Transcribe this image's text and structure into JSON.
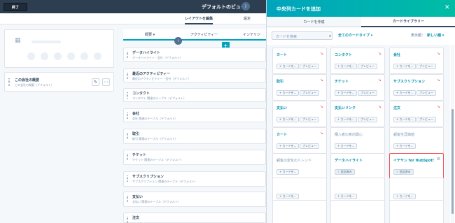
{
  "topbar": {
    "exit_label": "終了",
    "page_title": "デフォルトのビュー",
    "info_badge": "i"
  },
  "subtabs": [
    {
      "label": "レイアウトを編集"
    },
    {
      "label": "設定"
    }
  ],
  "left": {
    "section_title": "この会社の概要",
    "section_sub": "この会社の概要（デフォルト）",
    "edit_icon": "pencil-icon",
    "more_icon": "ellipsis-icon"
  },
  "middle": {
    "tabs": [
      {
        "label": "概要 ▾"
      },
      {
        "label": "アクティビティー"
      },
      {
        "label": "インテリジ"
      }
    ],
    "badge": "i",
    "plus": "+",
    "cards": [
      {
        "title": "データハイライト",
        "sub": "データハイライト・会社（デフォルト）"
      },
      {
        "title": "最近のアクティビティー",
        "sub": "最近のアクティビティー・会社（デフォルト）"
      },
      {
        "title": "コンタクト",
        "sub": "コンタクト 関連のテーブル（デフォルト）"
      },
      {
        "title": "会社",
        "sub": "会社 関連のテーブル（デフォルト）"
      },
      {
        "title": "取引",
        "sub": "取引 関連のテーブル（デフォルト）"
      },
      {
        "title": "チケット",
        "sub": "チケット 関連のテーブル（デフォルト）"
      },
      {
        "title": "サブスクリプション",
        "sub": "サブスクリプション 関連のテーブル（デフォルト）"
      },
      {
        "title": "支払い",
        "sub": "支払い 関連のテーブル（デフォルト）"
      },
      {
        "title": "注文",
        "sub": ""
      }
    ]
  },
  "overlay": {
    "title": "中央列カードを追加",
    "close": "✕",
    "tabs": [
      {
        "label": "カードを作成"
      },
      {
        "label": "カードライブラリー"
      }
    ],
    "search_placeholder": "カードを検索",
    "filter": "全てのカードタイプ ▾",
    "sort_label": "表示順：",
    "sort_value": "新しい順 ▾",
    "cards": [
      {
        "title": "カート",
        "add": "+ カードを...",
        "preview": "プレビュー"
      },
      {
        "title": "コンタクト",
        "add": "+ カードを...",
        "preview": "プレビュー"
      },
      {
        "title": "会社",
        "add": "+ カードを...",
        "preview": "プレビュー"
      },
      {
        "title": "取引",
        "add": "+ カードを...",
        "preview": "プレビュー"
      },
      {
        "title": "チケット",
        "add": "+ カードを...",
        "preview": "プレビュー"
      },
      {
        "title": "サブスクリプション",
        "add": "+ カードを...",
        "preview": "プレビュー"
      },
      {
        "title": "支払い",
        "add": "+ カードを...",
        "preview": "プレビュー"
      },
      {
        "title": "支払いリンク",
        "add": "+ カードを...",
        "preview": "プレビュー"
      },
      {
        "title": "注文",
        "add": "+ カードを...",
        "preview": "プレビュー"
      },
      {
        "title": "カート",
        "add": "+ カードを...",
        "preview": "プレビュー"
      },
      {
        "title": "購入者の意向関心",
        "add": "+ カードを...",
        "preview": ""
      },
      {
        "title": "顧客生涯価値",
        "add": "+ カードを...",
        "preview": ""
      },
      {
        "title": "顧客の変化のトレンド",
        "add": "+ カードを...",
        "preview": ""
      },
      {
        "title": "データハイライト",
        "add": "✓ 追加済み",
        "preview": ""
      },
      {
        "title": "イテヤン for HubSpot!",
        "add": "✓ 追加済み",
        "preview": ""
      },
      {
        "title": "",
        "add": "+ カードを...",
        "preview": ""
      },
      {
        "title": "",
        "add": "+ カードを...",
        "preview": ""
      },
      {
        "title": "",
        "add": "+ カードを...",
        "preview": ""
      },
      {
        "title": "",
        "add": "",
        "preview": ""
      },
      {
        "title": "",
        "add": "",
        "preview": ""
      },
      {
        "title": "",
        "add": "",
        "preview": ""
      }
    ]
  }
}
